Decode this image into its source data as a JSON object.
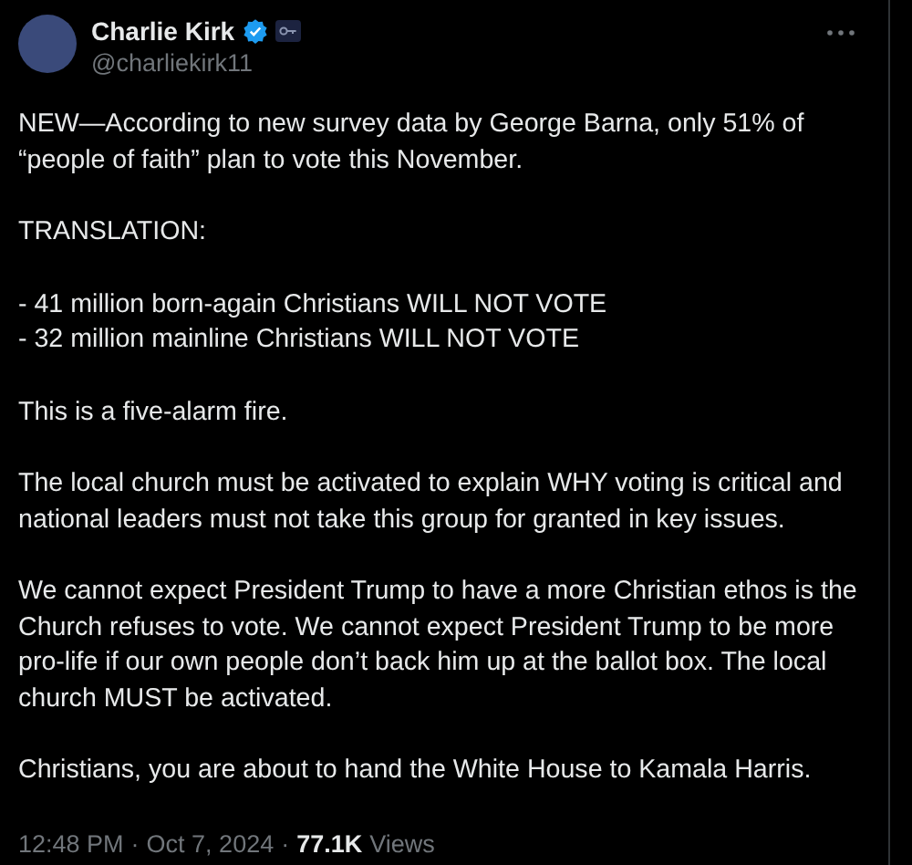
{
  "author": {
    "name": "Charlie Kirk",
    "handle": "@charliekirk11",
    "verified": true
  },
  "paragraphs": [
    [
      "NEW—According to new survey data by George Barna, only 51% of “people of faith” plan to vote this November."
    ],
    [
      "TRANSLATION:"
    ],
    [
      "- 41 million born-again Christians WILL NOT VOTE",
      "- 32 million mainline Christians WILL NOT VOTE"
    ],
    [
      "This is a five-alarm fire."
    ],
    [
      "The local church must be activated to explain WHY voting is critical and national leaders must not take this group for granted in key issues."
    ],
    [
      "We cannot expect President Trump to have a more Christian ethos is the Church refuses to vote. We cannot expect President Trump to be more pro-life if our own people don’t back him up at the ballot box. The local church MUST be activated."
    ],
    [
      "Christians, you are about to hand the White House to Kamala Harris."
    ]
  ],
  "meta": {
    "time": "12:48 PM",
    "separator_1": "·",
    "date": "Oct 7, 2024",
    "separator_2": "·",
    "views_count": "77.1K",
    "views_label": "Views"
  }
}
